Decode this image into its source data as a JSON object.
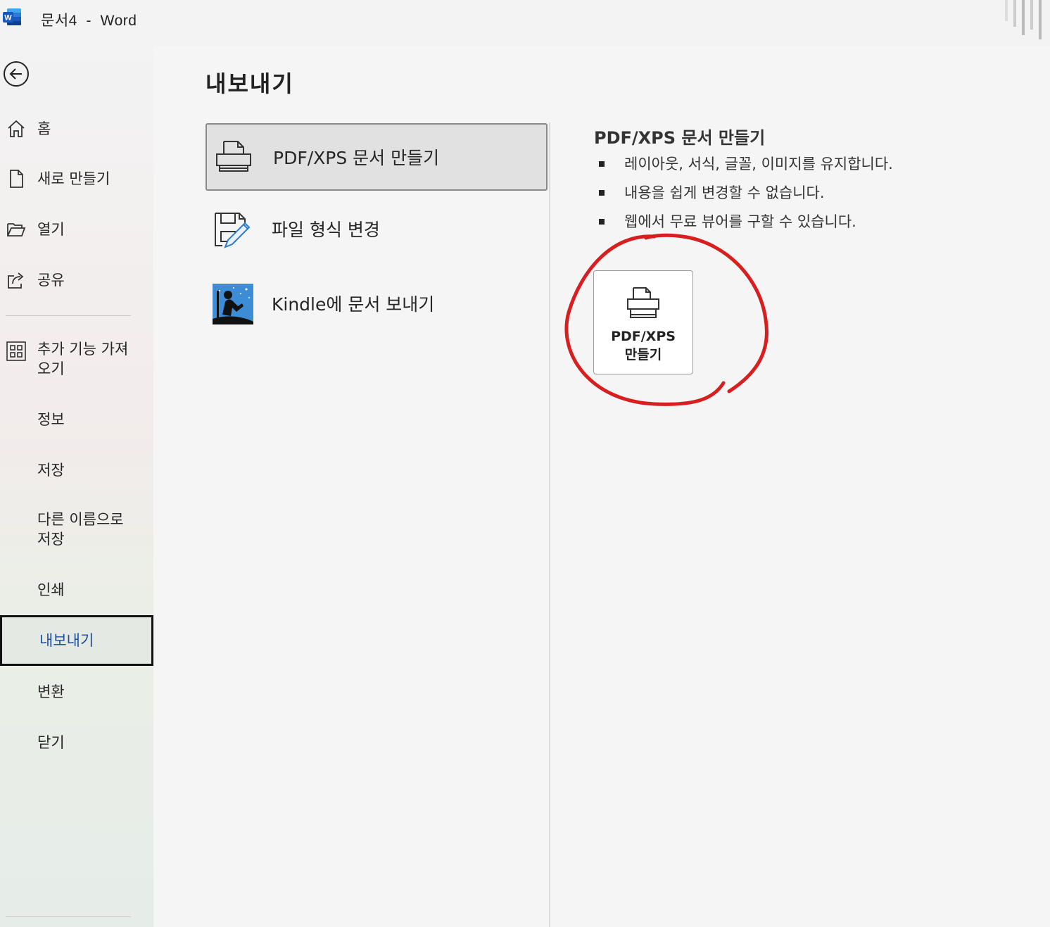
{
  "window": {
    "title": "문서4  -  Word",
    "accent_color": "#185abd"
  },
  "sidebar": {
    "back_icon": "arrow-left-circle-icon",
    "items": [
      {
        "label": "홈",
        "icon": "home-icon"
      },
      {
        "label": "새로 만들기",
        "icon": "new-document-icon"
      },
      {
        "label": "열기",
        "icon": "folder-open-icon"
      },
      {
        "label": "공유",
        "icon": "share-icon"
      },
      {
        "label": "추가 기능 가져\n오기",
        "icon": "addins-grid-icon"
      },
      {
        "label": "정보"
      },
      {
        "label": "저장"
      },
      {
        "label": "다른 이름으로\n저장"
      },
      {
        "label": "인쇄"
      },
      {
        "label": "내보내기",
        "active": true
      },
      {
        "label": "변환"
      },
      {
        "label": "닫기"
      }
    ]
  },
  "main": {
    "title": "내보내기",
    "options": [
      {
        "label": "PDF/XPS 문서 만들기",
        "icon": "pdf-printer-icon",
        "selected": true
      },
      {
        "label": "파일 형식 변경",
        "icon": "change-file-type-icon"
      },
      {
        "label": "Kindle에 문서 보내기",
        "icon": "kindle-icon"
      }
    ],
    "detail": {
      "title": "PDF/XPS 문서 만들기",
      "bullets": [
        "레이아웃, 서식, 글꼴, 이미지를 유지합니다.",
        "내용을 쉽게 변경할 수 없습니다.",
        "웹에서 무료 뷰어를 구할 수 있습니다."
      ],
      "button_label": "PDF/XPS\n만들기",
      "highlight_color": "#d81e1e"
    }
  }
}
